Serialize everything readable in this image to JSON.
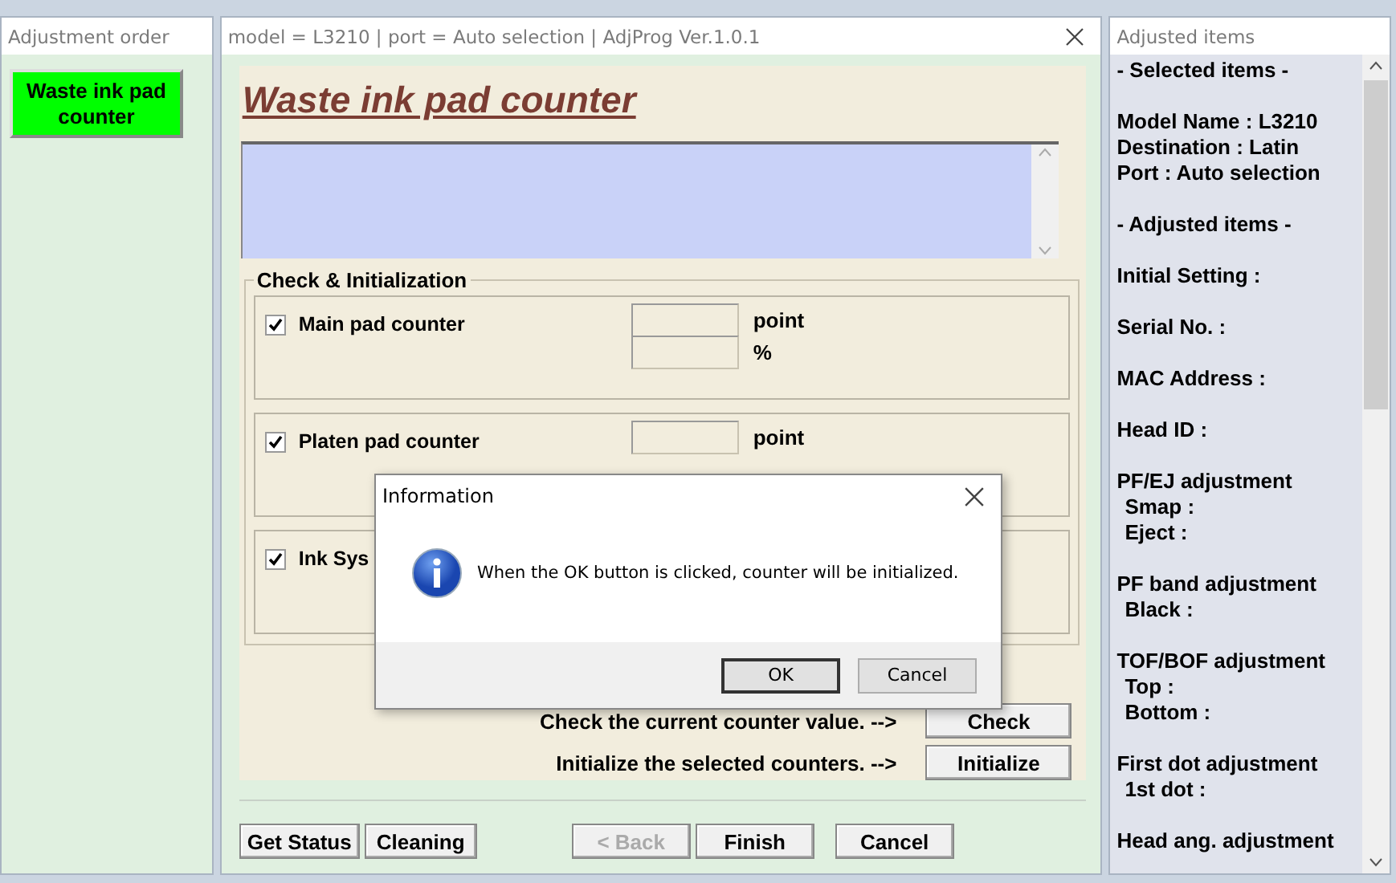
{
  "left_window": {
    "title": "Adjustment order",
    "items": [
      {
        "label": "Waste ink pad counter",
        "selected": true
      }
    ]
  },
  "main_window": {
    "title": "model = L3210 | port = Auto selection | AdjProg Ver.1.0.1",
    "heading": "Waste ink pad counter",
    "group": {
      "title": "Check & Initialization",
      "counters": [
        {
          "label": "Main pad counter",
          "checked": true,
          "fields": [
            {
              "unit": "point"
            },
            {
              "unit": "%"
            }
          ]
        },
        {
          "label": "Platen pad counter",
          "checked": true,
          "fields": [
            {
              "unit": "point"
            }
          ]
        },
        {
          "label": "Ink Sys",
          "checked": true
        }
      ]
    },
    "actions": [
      {
        "label": "Check the current counter value. -->",
        "button": "Check"
      },
      {
        "label": "Initialize the selected counters. -->",
        "button": "Initialize"
      }
    ],
    "footer_buttons": [
      {
        "label": "Get Status",
        "disabled": false,
        "kind": "left"
      },
      {
        "label": "Cleaning",
        "disabled": false,
        "kind": "left"
      },
      {
        "label": "< Back",
        "disabled": true,
        "kind": "nav"
      },
      {
        "label": "Finish",
        "disabled": false,
        "kind": "nav"
      },
      {
        "label": "Cancel",
        "disabled": false,
        "kind": "cancel"
      }
    ]
  },
  "right_window": {
    "title": "Adjusted items",
    "groups": [
      {
        "lines": [
          {
            "text": "- Selected items -"
          }
        ]
      },
      {
        "lines": [
          {
            "text": "Model Name : L3210"
          },
          {
            "text": "Destination : Latin"
          },
          {
            "text": "Port : Auto selection"
          }
        ]
      },
      {
        "lines": [
          {
            "text": "- Adjusted items -"
          }
        ]
      },
      {
        "lines": [
          {
            "text": "Initial Setting :"
          }
        ]
      },
      {
        "lines": [
          {
            "text": "Serial No. :"
          }
        ]
      },
      {
        "lines": [
          {
            "text": "MAC Address :"
          }
        ]
      },
      {
        "lines": [
          {
            "text": "Head ID :"
          }
        ]
      },
      {
        "lines": [
          {
            "text": "PF/EJ adjustment",
            "children": [
              {
                "text": "Smap :"
              },
              {
                "text": "Eject :"
              }
            ]
          }
        ]
      },
      {
        "lines": [
          {
            "text": "PF band adjustment",
            "children": [
              {
                "text": "Black :"
              }
            ]
          }
        ]
      },
      {
        "lines": [
          {
            "text": "TOF/BOF adjustment",
            "children": [
              {
                "text": "Top :"
              },
              {
                "text": "Bottom :"
              }
            ]
          }
        ]
      },
      {
        "lines": [
          {
            "text": "First dot adjustment",
            "children": [
              {
                "text": "1st dot :"
              }
            ]
          }
        ]
      },
      {
        "lines": [
          {
            "text": "Head ang. adjustment"
          }
        ]
      }
    ]
  },
  "dialog": {
    "title": "Information",
    "message": "When the OK button is clicked, counter will be initialized.",
    "buttons": [
      {
        "label": "OK",
        "default": true
      },
      {
        "label": "Cancel",
        "default": false
      }
    ]
  }
}
